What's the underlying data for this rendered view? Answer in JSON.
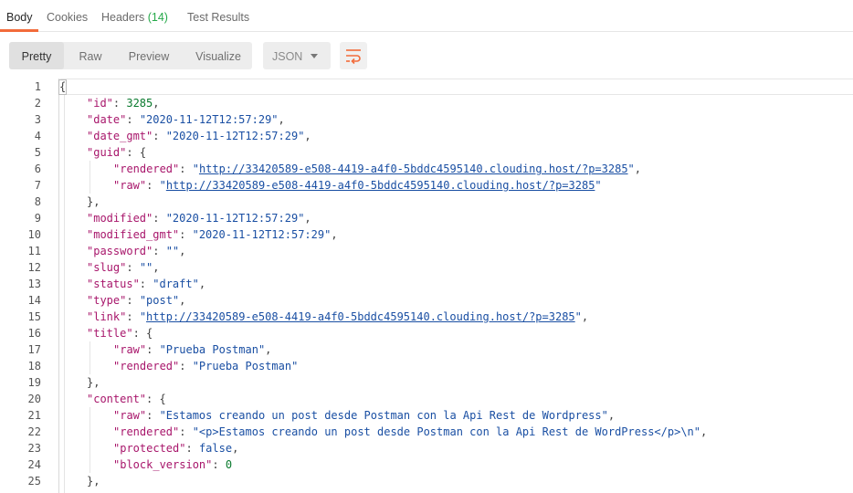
{
  "tabs": [
    {
      "label": "Body",
      "count": ""
    },
    {
      "label": "Cookies",
      "count": ""
    },
    {
      "label": "Headers",
      "count": "(14)"
    },
    {
      "label": "Test Results",
      "count": ""
    }
  ],
  "toolbar": {
    "views": [
      "Pretty",
      "Raw",
      "Preview",
      "Visualize"
    ],
    "format": "JSON",
    "wrap_icon": "wrap-lines-icon"
  },
  "colors": {
    "accent": "#f26b3a",
    "key": "#a8166b",
    "string": "#1a4fa3",
    "number": "#0a7a2e"
  },
  "lines": [
    {
      "n": "1",
      "i": 0,
      "k": "",
      "v": "",
      "t": "{",
      "c": ""
    },
    {
      "n": "2",
      "i": 1,
      "k": "\"id\"",
      "v": "3285",
      "t": "n",
      "c": ","
    },
    {
      "n": "3",
      "i": 1,
      "k": "\"date\"",
      "v": "\"2020-11-12T12:57:29\"",
      "t": "s",
      "c": ","
    },
    {
      "n": "4",
      "i": 1,
      "k": "\"date_gmt\"",
      "v": "\"2020-11-12T12:57:29\"",
      "t": "s",
      "c": ","
    },
    {
      "n": "5",
      "i": 1,
      "k": "\"guid\"",
      "v": "{",
      "t": "p",
      "c": ""
    },
    {
      "n": "6",
      "i": 2,
      "k": "\"rendered\"",
      "v": "http://33420589-e508-4419-a4f0-5bddc4595140.clouding.host/?p=3285",
      "t": "u",
      "c": ","
    },
    {
      "n": "7",
      "i": 2,
      "k": "\"raw\"",
      "v": "http://33420589-e508-4419-a4f0-5bddc4595140.clouding.host/?p=3285",
      "t": "u",
      "c": ""
    },
    {
      "n": "8",
      "i": 1,
      "k": "",
      "v": "},",
      "t": "p",
      "c": ""
    },
    {
      "n": "9",
      "i": 1,
      "k": "\"modified\"",
      "v": "\"2020-11-12T12:57:29\"",
      "t": "s",
      "c": ","
    },
    {
      "n": "10",
      "i": 1,
      "k": "\"modified_gmt\"",
      "v": "\"2020-11-12T12:57:29\"",
      "t": "s",
      "c": ","
    },
    {
      "n": "11",
      "i": 1,
      "k": "\"password\"",
      "v": "\"\"",
      "t": "s",
      "c": ","
    },
    {
      "n": "12",
      "i": 1,
      "k": "\"slug\"",
      "v": "\"\"",
      "t": "s",
      "c": ","
    },
    {
      "n": "13",
      "i": 1,
      "k": "\"status\"",
      "v": "\"draft\"",
      "t": "s",
      "c": ","
    },
    {
      "n": "14",
      "i": 1,
      "k": "\"type\"",
      "v": "\"post\"",
      "t": "s",
      "c": ","
    },
    {
      "n": "15",
      "i": 1,
      "k": "\"link\"",
      "v": "http://33420589-e508-4419-a4f0-5bddc4595140.clouding.host/?p=3285",
      "t": "u",
      "c": ","
    },
    {
      "n": "16",
      "i": 1,
      "k": "\"title\"",
      "v": "{",
      "t": "p",
      "c": ""
    },
    {
      "n": "17",
      "i": 2,
      "k": "\"raw\"",
      "v": "\"Prueba Postman\"",
      "t": "s",
      "c": ","
    },
    {
      "n": "18",
      "i": 2,
      "k": "\"rendered\"",
      "v": "\"Prueba Postman\"",
      "t": "s",
      "c": ""
    },
    {
      "n": "19",
      "i": 1,
      "k": "",
      "v": "},",
      "t": "p",
      "c": ""
    },
    {
      "n": "20",
      "i": 1,
      "k": "\"content\"",
      "v": "{",
      "t": "p",
      "c": ""
    },
    {
      "n": "21",
      "i": 2,
      "k": "\"raw\"",
      "v": "\"Estamos creando un post desde Postman con la Api Rest de Wordpress\"",
      "t": "s",
      "c": ","
    },
    {
      "n": "22",
      "i": 2,
      "k": "\"rendered\"",
      "v": "\"<p>Estamos creando un post desde Postman con la Api Rest de WordPress</p>\\n\"",
      "t": "s",
      "c": ","
    },
    {
      "n": "23",
      "i": 2,
      "k": "\"protected\"",
      "v": "false",
      "t": "s",
      "c": ","
    },
    {
      "n": "24",
      "i": 2,
      "k": "\"block_version\"",
      "v": "0",
      "t": "n",
      "c": ""
    },
    {
      "n": "25",
      "i": 1,
      "k": "",
      "v": "},",
      "t": "p",
      "c": ""
    }
  ]
}
